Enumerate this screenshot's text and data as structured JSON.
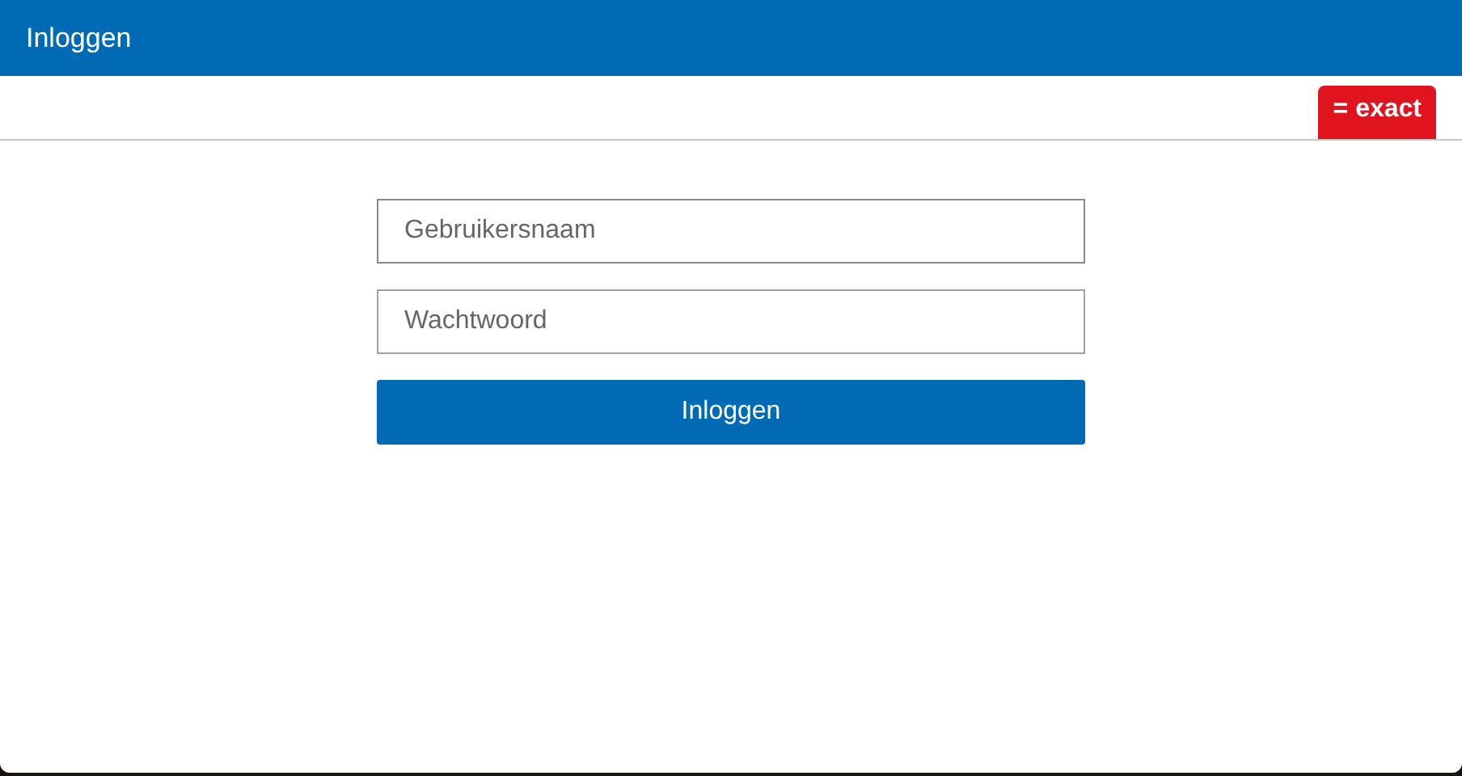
{
  "header": {
    "title": "Inloggen"
  },
  "logo": {
    "text": "= exact"
  },
  "form": {
    "fields": [
      {
        "placeholder": "Gebruikersnaam",
        "focused": true
      },
      {
        "placeholder": "Wachtwoord",
        "focused": false
      }
    ],
    "submit": "Inloggen"
  }
}
